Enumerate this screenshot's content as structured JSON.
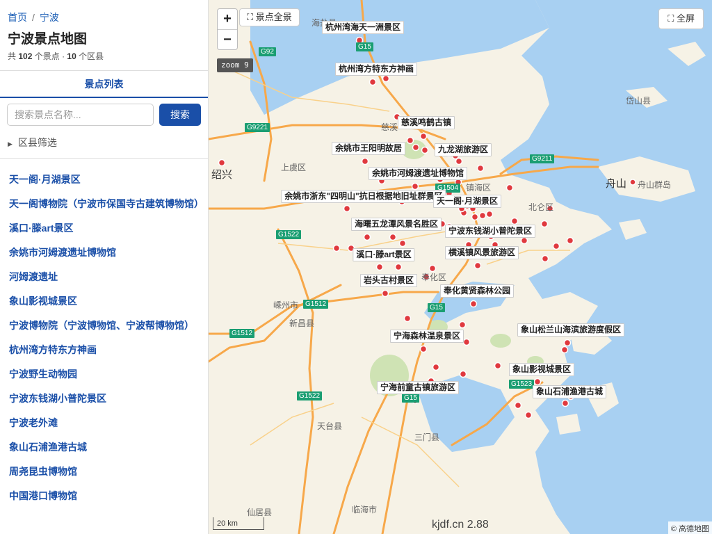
{
  "breadcrumb": {
    "home": "首页",
    "sep": "/",
    "current": "宁波"
  },
  "title": "宁波景点地图",
  "summary": {
    "prefix": "共",
    "spot_count": "102",
    "mid": "个景点 ·",
    "district_count": "10",
    "suffix": "个区县"
  },
  "tab": "景点列表",
  "search": {
    "placeholder": "搜索景点名称...",
    "button": "搜索"
  },
  "filter": {
    "label": "区县筛选"
  },
  "spots": [
    "天一阁·月湖景区",
    "天一阁博物院（宁波市保国寺古建筑博物馆）",
    "溪口·滕art景区",
    "余姚市河姆渡遗址博物馆",
    "河姆渡遗址",
    "象山影视城景区",
    "宁波博物院（宁波博物馆、宁波帮博物馆）",
    "杭州湾方特东方神画",
    "宁波野生动物园",
    "宁波东钱湖小普陀景区",
    "宁波老外滩",
    "象山石浦渔港古城",
    "周尧昆虫博物馆",
    "中国港口博物馆"
  ],
  "map": {
    "zoom_in": "+",
    "zoom_out": "−",
    "overview": "景点全景",
    "fullscreen": "全屏",
    "zoom_level": "zoom 9",
    "scale": "20 km",
    "watermark": "kjdf.cn 2.88",
    "attribution": "© 高德地图",
    "colors": {
      "sea": "#a8d0f2",
      "land": "#f6f2e6",
      "road": "#f7a84a",
      "marker": "#e0393e",
      "forest": "#cfe3b4"
    },
    "spot_labels": [
      "杭州湾海天一洲景区",
      "杭州湾方特东方神画",
      "慈溪鸣鹤古镇",
      "余姚市王阳明故居",
      "九龙湖旅游区",
      "余姚市河姆渡遗址博物馆",
      "余姚市浙东\"四明山\"抗日根据地旧址群景区",
      "天一阁·月湖景区",
      "海曙五龙潭风景名胜区",
      "宁波东钱湖小普陀景区",
      "溪口·滕art景区",
      "横溪镇风景旅游区",
      "岩头古村景区",
      "奉化黄贤森林公园",
      "宁海森林温泉景区",
      "象山松兰山海滨旅游度假区",
      "象山影视城景区",
      "象山石浦渔港古城",
      "宁海前童古镇旅游区"
    ],
    "places": [
      "海盐县",
      "慈溪",
      "上虞区",
      "绍兴",
      "镇海区",
      "北仑区",
      "舟山",
      "舟山群岛",
      "岱山县",
      "嵊州市",
      "新昌县",
      "奉化区",
      "天台县",
      "三门县",
      "仙居县",
      "临海市"
    ],
    "roads": [
      "G15",
      "G92",
      "G9221",
      "G9211",
      "G1504",
      "G1522",
      "G1512",
      "G1512",
      "G15",
      "G1522",
      "G1523",
      "G15"
    ]
  }
}
